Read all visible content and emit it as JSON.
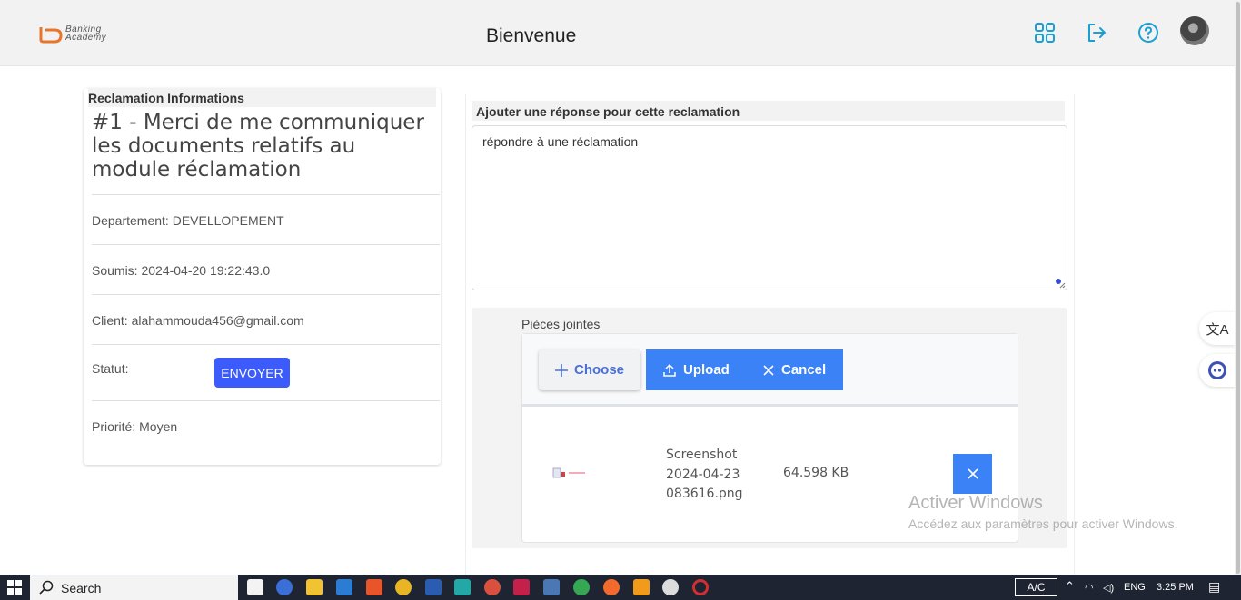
{
  "header": {
    "logo_text_1": "Banking",
    "logo_text_2": "Academy",
    "title": "Bienvenue",
    "icons": [
      "grid-icon",
      "logout-icon",
      "help-icon",
      "avatar"
    ]
  },
  "reclamation": {
    "section_title": "Reclamation Informations",
    "title": "#1 - Merci de me communiquer les documents relatifs au module réclamation",
    "departement": "Departement: DEVELLOPEMENT",
    "soumis": "Soumis: 2024-04-20 19:22:43.0",
    "client": "Client: alahammouda456@gmail.com",
    "statut_label": "Statut:",
    "statut_button": "ENVOYER",
    "priorite": "Priorité: Moyen"
  },
  "response": {
    "label": "Ajouter une réponse pour cette reclamation",
    "textarea_value": "répondre à une réclamation",
    "attachments_label": "Pièces jointes",
    "choose_label": "Choose",
    "upload_label": "Upload",
    "cancel_label": "Cancel",
    "file": {
      "name": "Screenshot 2024-04-23 083616.png",
      "size": "64.598 KB"
    }
  },
  "watermark": {
    "title": "Activer Windows",
    "subtitle": "Accédez aux paramètres pour activer Windows."
  },
  "taskbar": {
    "search_label": "Search",
    "ac": "A/C",
    "lang": "ENG",
    "time": "3:25 PM"
  },
  "colors": {
    "accent_blue": "#3b82f6",
    "status_blue": "#3b5bfb",
    "header_bg": "#f2f2f3",
    "icon_teal": "#1a9fd4",
    "taskbar_bg": "#1f2433"
  }
}
